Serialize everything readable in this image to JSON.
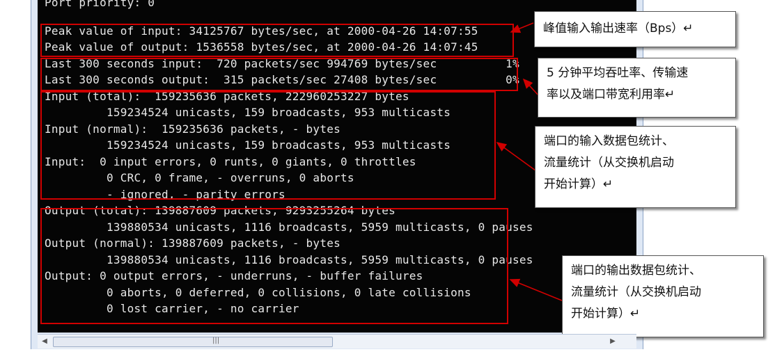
{
  "terminal": {
    "lines": [
      "Port priority: 0",
      "Peak value of input: 34125767 bytes/sec, at 2000-04-26 14:07:55",
      "Peak value of output: 1536558 bytes/sec, at 2000-04-26 14:07:45",
      "Last 300 seconds input:  720 packets/sec 994769 bytes/sec          1%",
      "Last 300 seconds output:  315 packets/sec 27408 bytes/sec          0%",
      "Input (total):  159235636 packets, 222960253227 bytes",
      "         159234524 unicasts, 159 broadcasts, 953 multicasts",
      "Input (normal):  159235636 packets, - bytes",
      "         159234524 unicasts, 159 broadcasts, 953 multicasts",
      "Input:  0 input errors, 0 runts, 0 giants, 0 throttles",
      "         0 CRC, 0 frame, - overruns, 0 aborts",
      "         - ignored, - parity errors",
      "Output (total): 139887609 packets, 9293255264 bytes",
      "         139880534 unicasts, 1116 broadcasts, 5959 multicasts, 0 pauses",
      "Output (normal): 139887609 packets, - bytes",
      "         139880534 unicasts, 1116 broadcasts, 5959 multicasts, 0 pauses",
      "Output: 0 output errors, - underruns, - buffer failures",
      "         0 aborts, 0 deferred, 0 collisions, 0 late collisions",
      "         0 lost carrier, - no carrier"
    ]
  },
  "callouts": {
    "peak": "峰值输入输出速率（Bps）↵",
    "avg": "5 分钟平均吞吐率、传输速\n率以及端口带宽利用率↵",
    "input": "端口的输入数据包统计、\n流量统计（从交换机启动\n开始计算）↵",
    "output": "端口的输出数据包统计、\n流量统计（从交换机启动\n开始计算）↵"
  },
  "scrollbar": {
    "left_arrow": "◀",
    "grip": "|||",
    "right_arrow": "▶"
  },
  "colors": {
    "highlight": "#d10000",
    "terminal_bg": "#050505",
    "terminal_text": "#e8e8e8"
  }
}
